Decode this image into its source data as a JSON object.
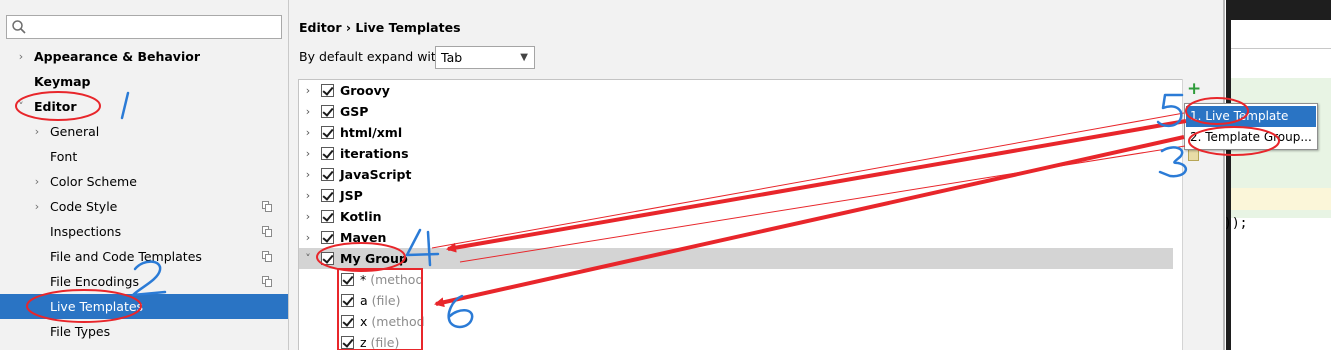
{
  "settings": {
    "search": {
      "placeholder": ""
    },
    "tree": [
      {
        "label": "Appearance & Behavior",
        "bold": true,
        "arrow": "›",
        "indent": 0,
        "copy": false,
        "selected": false
      },
      {
        "label": "Keymap",
        "bold": true,
        "arrow": "",
        "indent": 0,
        "copy": false,
        "selected": false
      },
      {
        "label": "Editor",
        "bold": true,
        "arrow": "⌄",
        "indent": 0,
        "copy": false,
        "selected": false
      },
      {
        "label": "General",
        "bold": false,
        "arrow": "›",
        "indent": 1,
        "copy": false,
        "selected": false
      },
      {
        "label": "Font",
        "bold": false,
        "arrow": "",
        "indent": 1,
        "copy": false,
        "selected": false
      },
      {
        "label": "Color Scheme",
        "bold": false,
        "arrow": "›",
        "indent": 1,
        "copy": false,
        "selected": false
      },
      {
        "label": "Code Style",
        "bold": false,
        "arrow": "›",
        "indent": 1,
        "copy": true,
        "selected": false
      },
      {
        "label": "Inspections",
        "bold": false,
        "arrow": "",
        "indent": 1,
        "copy": true,
        "selected": false
      },
      {
        "label": "File and Code Templates",
        "bold": false,
        "arrow": "",
        "indent": 1,
        "copy": true,
        "selected": false
      },
      {
        "label": "File Encodings",
        "bold": false,
        "arrow": "",
        "indent": 1,
        "copy": true,
        "selected": false
      },
      {
        "label": "Live Templates",
        "bold": false,
        "arrow": "",
        "indent": 1,
        "copy": false,
        "selected": true
      },
      {
        "label": "File Types",
        "bold": false,
        "arrow": "",
        "indent": 1,
        "copy": false,
        "selected": false
      }
    ]
  },
  "content": {
    "breadcrumb": "Editor › Live Templates",
    "expand_label": "By default expand with",
    "expand_value": "Tab",
    "groups": [
      {
        "name": "Groovy",
        "expanded": false,
        "selected": false
      },
      {
        "name": "GSP",
        "expanded": false,
        "selected": false
      },
      {
        "name": "html/xml",
        "expanded": false,
        "selected": false
      },
      {
        "name": "iterations",
        "expanded": false,
        "selected": false
      },
      {
        "name": "JavaScript",
        "expanded": false,
        "selected": false
      },
      {
        "name": "JSP",
        "expanded": false,
        "selected": false
      },
      {
        "name": "Kotlin",
        "expanded": false,
        "selected": false
      },
      {
        "name": "Maven",
        "expanded": false,
        "selected": false
      },
      {
        "name": "My Group",
        "expanded": true,
        "selected": true
      }
    ],
    "templates": [
      {
        "abbr": "*",
        "desc": "(method"
      },
      {
        "abbr": "a",
        "desc": "(file)"
      },
      {
        "abbr": "x",
        "desc": "(method"
      },
      {
        "abbr": "z",
        "desc": "(file)"
      }
    ]
  },
  "popup_menu": {
    "items": [
      {
        "label": "1. Live Template",
        "active": true
      },
      {
        "label": "2. Template Group...",
        "active": false
      }
    ]
  },
  "editor_background": {
    "code_fragment": "));"
  },
  "annotations": {
    "numbers": [
      "1",
      "2",
      "3",
      "4",
      "5",
      "6"
    ],
    "color": "#e8262b",
    "digit_color": "#2b7bd6"
  },
  "colors": {
    "selection": "#2a74c4",
    "group_highlight": "#d4d4d4",
    "add_icon": "#2e9b3a"
  }
}
